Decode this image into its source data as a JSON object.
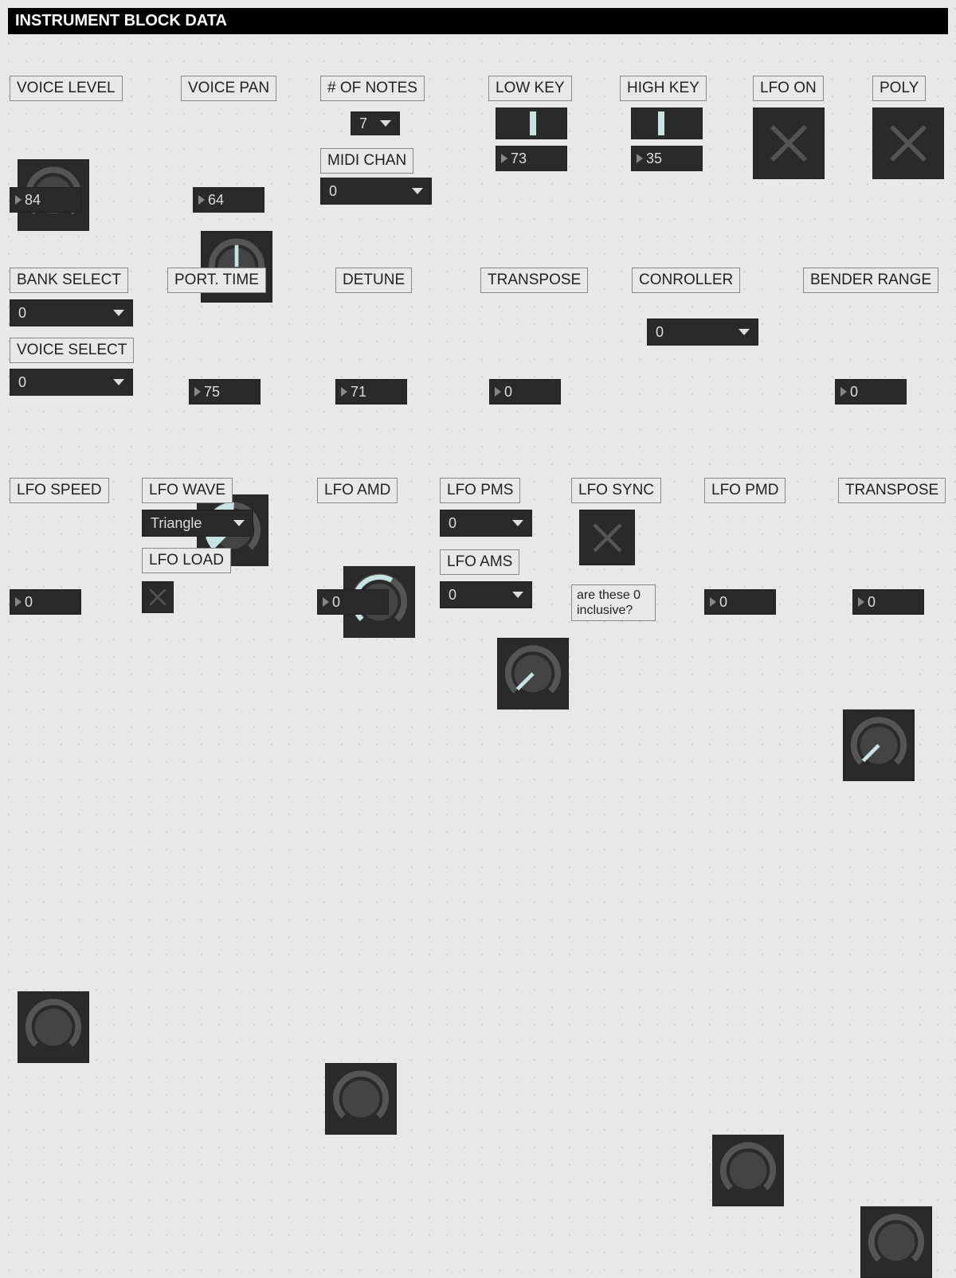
{
  "title": "INSTRUMENT BLOCK DATA",
  "row1": {
    "voice_level": {
      "label": "VOICE LEVEL",
      "value": "84",
      "angle": -135
    },
    "voice_pan": {
      "label": "VOICE PAN",
      "value": "64",
      "angle": 0
    },
    "notes": {
      "label": "# OF NOTES",
      "value": "7"
    },
    "midi_chan": {
      "label": "MIDI CHAN",
      "value": "0"
    },
    "low_key": {
      "label": "LOW KEY",
      "value": "73"
    },
    "high_key": {
      "label": "HIGH KEY",
      "value": "35"
    },
    "lfo_on": {
      "label": "LFO ON"
    },
    "poly": {
      "label": "POLY"
    }
  },
  "row2": {
    "bank_select": {
      "label": "BANK SELECT",
      "value": "0"
    },
    "voice_select": {
      "label": "VOICE SELECT",
      "value": "0"
    },
    "port_time": {
      "label": "PORT. TIME",
      "value": "75"
    },
    "detune": {
      "label": "DETUNE",
      "value": "71"
    },
    "transpose": {
      "label": "TRANSPOSE",
      "value": "0"
    },
    "controller": {
      "label": "CONROLLER",
      "value": "0"
    },
    "bender": {
      "label": "BENDER RANGE",
      "value": "0"
    }
  },
  "row3": {
    "lfo_speed": {
      "label": "LFO SPEED",
      "value": "0"
    },
    "lfo_wave": {
      "label": "LFO WAVE",
      "value": "Triangle"
    },
    "lfo_load": {
      "label": "LFO LOAD"
    },
    "lfo_amd": {
      "label": "LFO AMD",
      "value": "0"
    },
    "lfo_pms": {
      "label": "LFO PMS",
      "value": "0"
    },
    "lfo_ams": {
      "label": "LFO AMS",
      "value": "0"
    },
    "lfo_sync": {
      "label": "LFO SYNC"
    },
    "lfo_pmd": {
      "label": "LFO PMD",
      "value": "0"
    },
    "transpose": {
      "label": "TRANSPOSE",
      "value": "0"
    },
    "note": "are these 0 inclusive?"
  }
}
